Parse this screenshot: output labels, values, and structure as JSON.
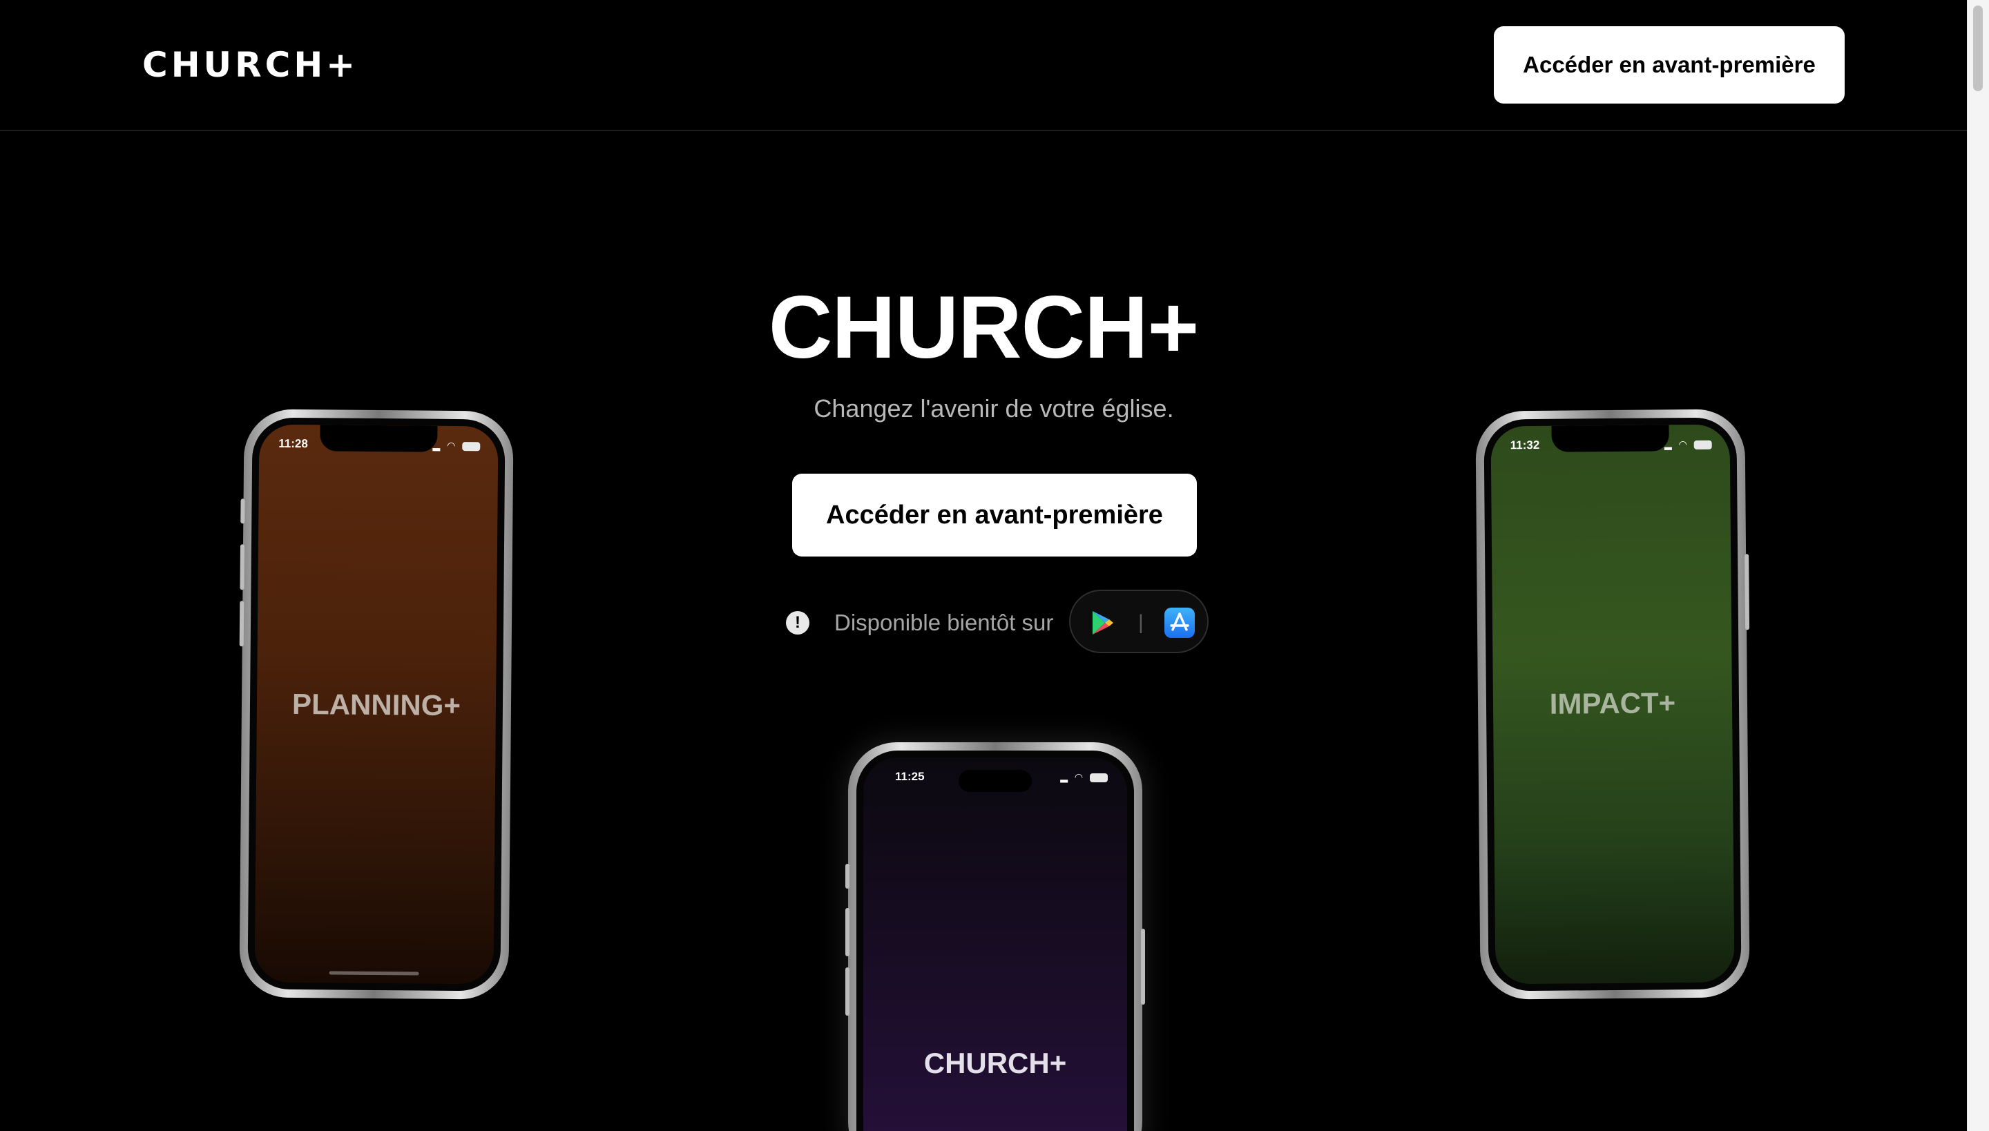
{
  "header": {
    "logo": "CHURCH+",
    "cta_label": "Accéder en avant-première"
  },
  "hero": {
    "title": "CHURCH+",
    "subtitle": "Changez l'avenir de votre église.",
    "cta_label": "Accéder en avant-première",
    "availability_text": "Disponible bientôt sur",
    "info_symbol": "!",
    "store_separator": "|",
    "store_icons": [
      "google-play-icon",
      "app-store-icon"
    ]
  },
  "phones": {
    "left": {
      "time": "11:28",
      "label": "PLANNING+",
      "color": "#4c220b"
    },
    "center": {
      "time": "11:25",
      "label": "CHURCH+",
      "color": "#1a0c28"
    },
    "right": {
      "time": "11:32",
      "label": "IMPACT+",
      "color": "#35571f"
    }
  },
  "colors": {
    "background": "#000000",
    "button_bg": "#ffffff",
    "button_text": "#000000",
    "subtitle": "#b9b9b9"
  }
}
